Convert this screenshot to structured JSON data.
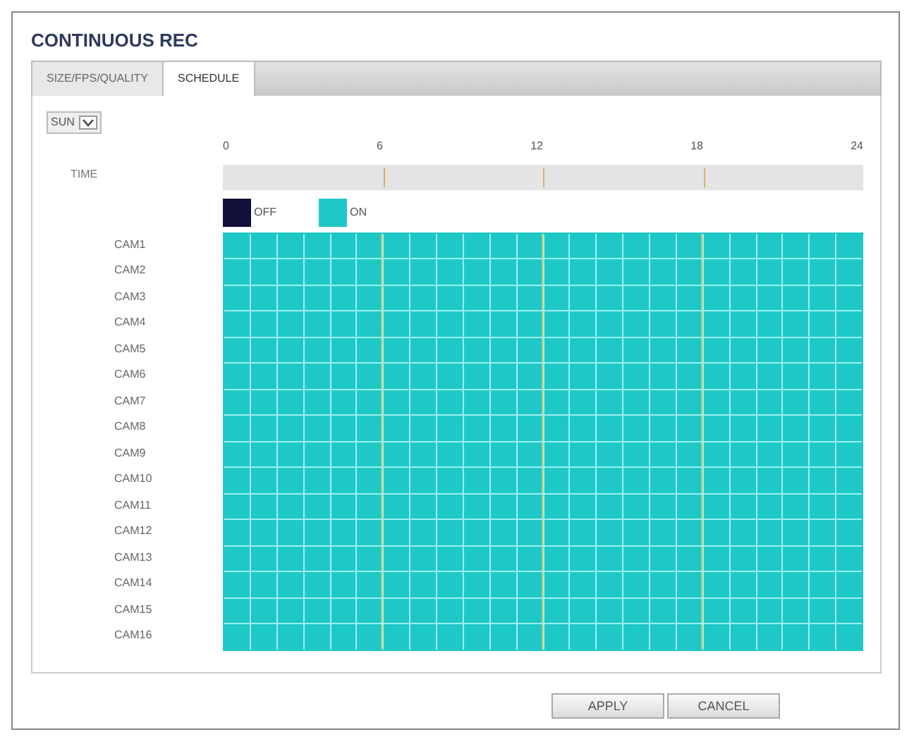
{
  "window": {
    "title": "CONTINUOUS REC"
  },
  "tabs": [
    {
      "label": "SIZE/FPS/QUALITY",
      "selected": false
    },
    {
      "label": "SCHEDULE",
      "selected": true
    }
  ],
  "day_select": {
    "value": "SUN"
  },
  "time_bar": {
    "label": "TIME",
    "ticks": [
      "0",
      "6",
      "12",
      "18",
      "24"
    ]
  },
  "legend": [
    {
      "label": "OFF",
      "color": "#10103a"
    },
    {
      "label": "ON",
      "color": "#1ec8c6"
    }
  ],
  "cameras": [
    {
      "name": "CAM1",
      "hours": [
        true,
        true,
        true,
        true,
        true,
        true,
        true,
        true,
        true,
        true,
        true,
        true,
        true,
        true,
        true,
        true,
        true,
        true,
        true,
        true,
        true,
        true,
        true,
        true
      ]
    },
    {
      "name": "CAM2",
      "hours": [
        true,
        true,
        true,
        true,
        true,
        true,
        true,
        true,
        true,
        true,
        true,
        true,
        true,
        true,
        true,
        true,
        true,
        true,
        true,
        true,
        true,
        true,
        true,
        true
      ]
    },
    {
      "name": "CAM3",
      "hours": [
        true,
        true,
        true,
        true,
        true,
        true,
        true,
        true,
        true,
        true,
        true,
        true,
        true,
        true,
        true,
        true,
        true,
        true,
        true,
        true,
        true,
        true,
        true,
        true
      ]
    },
    {
      "name": "CAM4",
      "hours": [
        true,
        true,
        true,
        true,
        true,
        true,
        true,
        true,
        true,
        true,
        true,
        true,
        true,
        true,
        true,
        true,
        true,
        true,
        true,
        true,
        true,
        true,
        true,
        true
      ]
    },
    {
      "name": "CAM5",
      "hours": [
        true,
        true,
        true,
        true,
        true,
        true,
        true,
        true,
        true,
        true,
        true,
        true,
        true,
        true,
        true,
        true,
        true,
        true,
        true,
        true,
        true,
        true,
        true,
        true
      ]
    },
    {
      "name": "CAM6",
      "hours": [
        true,
        true,
        true,
        true,
        true,
        true,
        true,
        true,
        true,
        true,
        true,
        true,
        true,
        true,
        true,
        true,
        true,
        true,
        true,
        true,
        true,
        true,
        true,
        true
      ]
    },
    {
      "name": "CAM7",
      "hours": [
        true,
        true,
        true,
        true,
        true,
        true,
        true,
        true,
        true,
        true,
        true,
        true,
        true,
        true,
        true,
        true,
        true,
        true,
        true,
        true,
        true,
        true,
        true,
        true
      ]
    },
    {
      "name": "CAM8",
      "hours": [
        true,
        true,
        true,
        true,
        true,
        true,
        true,
        true,
        true,
        true,
        true,
        true,
        true,
        true,
        true,
        true,
        true,
        true,
        true,
        true,
        true,
        true,
        true,
        true
      ]
    },
    {
      "name": "CAM9",
      "hours": [
        true,
        true,
        true,
        true,
        true,
        true,
        true,
        true,
        true,
        true,
        true,
        true,
        true,
        true,
        true,
        true,
        true,
        true,
        true,
        true,
        true,
        true,
        true,
        true
      ]
    },
    {
      "name": "CAM10",
      "hours": [
        true,
        true,
        true,
        true,
        true,
        true,
        true,
        true,
        true,
        true,
        true,
        true,
        true,
        true,
        true,
        true,
        true,
        true,
        true,
        true,
        true,
        true,
        true,
        true
      ]
    },
    {
      "name": "CAM11",
      "hours": [
        true,
        true,
        true,
        true,
        true,
        true,
        true,
        true,
        true,
        true,
        true,
        true,
        true,
        true,
        true,
        true,
        true,
        true,
        true,
        true,
        true,
        true,
        true,
        true
      ]
    },
    {
      "name": "CAM12",
      "hours": [
        true,
        true,
        true,
        true,
        true,
        true,
        true,
        true,
        true,
        true,
        true,
        true,
        true,
        true,
        true,
        true,
        true,
        true,
        true,
        true,
        true,
        true,
        true,
        true
      ]
    },
    {
      "name": "CAM13",
      "hours": [
        true,
        true,
        true,
        true,
        true,
        true,
        true,
        true,
        true,
        true,
        true,
        true,
        true,
        true,
        true,
        true,
        true,
        true,
        true,
        true,
        true,
        true,
        true,
        true
      ]
    },
    {
      "name": "CAM14",
      "hours": [
        true,
        true,
        true,
        true,
        true,
        true,
        true,
        true,
        true,
        true,
        true,
        true,
        true,
        true,
        true,
        true,
        true,
        true,
        true,
        true,
        true,
        true,
        true,
        true
      ]
    },
    {
      "name": "CAM15",
      "hours": [
        true,
        true,
        true,
        true,
        true,
        true,
        true,
        true,
        true,
        true,
        true,
        true,
        true,
        true,
        true,
        true,
        true,
        true,
        true,
        true,
        true,
        true,
        true,
        true
      ]
    },
    {
      "name": "CAM16",
      "hours": [
        true,
        true,
        true,
        true,
        true,
        true,
        true,
        true,
        true,
        true,
        true,
        true,
        true,
        true,
        true,
        true,
        true,
        true,
        true,
        true,
        true,
        true,
        true,
        true
      ]
    }
  ],
  "buttons": [
    {
      "label": "APPLY"
    },
    {
      "label": "CANCEL"
    }
  ]
}
